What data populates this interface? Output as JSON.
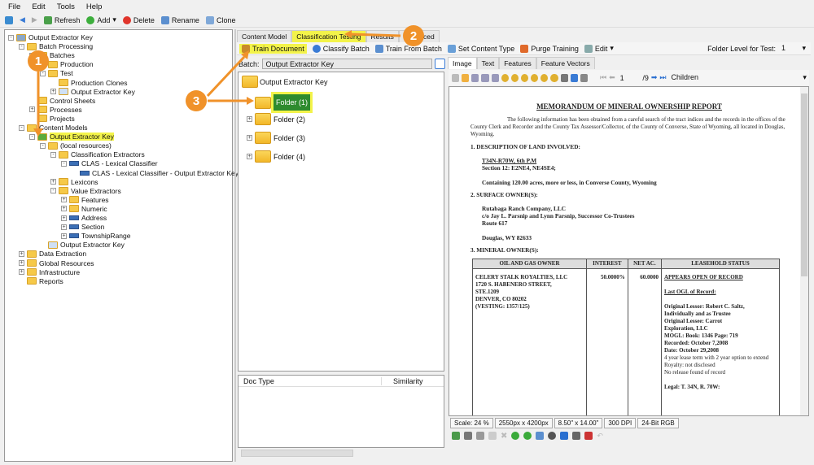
{
  "menu": [
    "File",
    "Edit",
    "Tools",
    "Help"
  ],
  "toolbar": {
    "refresh": "Refresh",
    "add": "Add",
    "delete": "Delete",
    "rename": "Rename",
    "clone": "Clone"
  },
  "tree": [
    {
      "label": "Output Extractor Key",
      "level": 0,
      "icon": "database-icon",
      "exp": "-"
    },
    {
      "label": "Batch Processing",
      "level": 1,
      "icon": "folder-icon",
      "exp": "-"
    },
    {
      "label": "Batches",
      "level": 2,
      "icon": "folder-icon",
      "exp": "-"
    },
    {
      "label": "Production",
      "level": 3,
      "icon": "batch-folder-icon",
      "exp": ""
    },
    {
      "label": "Test",
      "level": 3,
      "icon": "batch-folder-icon",
      "exp": "-"
    },
    {
      "label": "Production Clones",
      "level": 4,
      "icon": "batch-folder-icon",
      "exp": ""
    },
    {
      "label": "Output Extractor Key",
      "level": 4,
      "icon": "batch-icon",
      "exp": "+"
    },
    {
      "label": "Control Sheets",
      "level": 2,
      "icon": "folder-icon",
      "exp": ""
    },
    {
      "label": "Processes",
      "level": 2,
      "icon": "folder-icon",
      "exp": "+"
    },
    {
      "label": "Projects",
      "level": 2,
      "icon": "folder-icon",
      "exp": ""
    },
    {
      "label": "Content Models",
      "level": 1,
      "icon": "folder-icon",
      "exp": "-"
    },
    {
      "label": "Output Extractor Key",
      "level": 2,
      "icon": "content-model-icon",
      "exp": "-",
      "highlight": true
    },
    {
      "label": "(local resources)",
      "level": 3,
      "icon": "folder-icon",
      "exp": "-"
    },
    {
      "label": "Classification Extractors",
      "level": 4,
      "icon": "folder-icon",
      "exp": "-"
    },
    {
      "label": "CLAS - Lexical Classifier",
      "level": 5,
      "icon": "extractor-icon",
      "exp": "-"
    },
    {
      "label": "CLAS - Lexical Classifier - Output Extractor Key",
      "level": 6,
      "icon": "extractor-icon",
      "exp": ""
    },
    {
      "label": "Lexicons",
      "level": 4,
      "icon": "folder-icon",
      "exp": "+"
    },
    {
      "label": "Value Extractors",
      "level": 4,
      "icon": "folder-icon",
      "exp": "-"
    },
    {
      "label": "Features",
      "level": 5,
      "icon": "folder-icon",
      "exp": "+"
    },
    {
      "label": "Numeric",
      "level": 5,
      "icon": "folder-icon",
      "exp": "+"
    },
    {
      "label": "Address",
      "level": 5,
      "icon": "extractor-icon",
      "exp": "+"
    },
    {
      "label": "Section",
      "level": 5,
      "icon": "extractor-icon",
      "exp": "+"
    },
    {
      "label": "TownshipRange",
      "level": 5,
      "icon": "extractor-icon",
      "exp": "+"
    },
    {
      "label": "Output Extractor Key",
      "level": 3,
      "icon": "document-icon",
      "exp": ""
    },
    {
      "label": "Data Extraction",
      "level": 1,
      "icon": "folder-icon",
      "exp": "+"
    },
    {
      "label": "Global Resources",
      "level": 1,
      "icon": "folder-icon",
      "exp": "+"
    },
    {
      "label": "Infrastructure",
      "level": 1,
      "icon": "folder-icon",
      "exp": "+"
    },
    {
      "label": "Reports",
      "level": 1,
      "icon": "folder-icon",
      "exp": ""
    }
  ],
  "mid": {
    "tabs": [
      "Content Model",
      "Classification Testing",
      "Results",
      "Advanced"
    ],
    "toolbar": {
      "train_document": "Train Document",
      "classify_batch": "Classify Batch",
      "train_from_batch": "Train From Batch",
      "set_content_type": "Set Content Type",
      "purge_training": "Purge Training",
      "edit": "Edit",
      "folder_level_label": "Folder Level for Test:",
      "folder_level_value": "1"
    },
    "batch_label": "Batch:",
    "batch_value": "Output Extractor Key",
    "root_folder": "Output Extractor Key",
    "folders": [
      "Folder (1)",
      "Folder (2)",
      "Folder (3)",
      "Folder (4)"
    ],
    "list_headers": [
      "Doc Type",
      "Similarity"
    ]
  },
  "viewer": {
    "tabs": [
      "Image",
      "Text",
      "Features",
      "Feature Vectors"
    ],
    "page_current": "1",
    "page_total": "/9",
    "view_mode": "Children",
    "status": [
      "Scale: 24 %",
      "2550px x 4200px",
      "8.50\" x 14.00\"",
      "300 DPI",
      "24-Bit RGB"
    ]
  },
  "document": {
    "title": "MEMORANDUM OF MINERAL OWNERSHIP REPORT",
    "intro": "The following information has been obtained from a careful search of the tract indices and the records in the offices of the County Clerk and Recorder and the County Tax Assessor/Collector, of the County of Converse, State of Wyoming, all located in Douglas, Wyoming.",
    "s1": "1.   DESCRIPTION OF LAND INVOLVED:",
    "s1a": "T34N-R70W, 6th P.M",
    "s1b": "Section 12: E2NE4, NE4SE4;",
    "s1c": "Containing 120.00 acres, more or less, in Converse County, Wyoming",
    "s2": "2.   SURFACE OWNER(S):",
    "s2a": "Rutabaga Ranch Company, LLC",
    "s2b": "c/o Jay L. Parsnip and Lynn Parsnip, Successor Co-Trustees",
    "s2c": "Route 617",
    "s2d": "Douglas, WY 82633",
    "s3": "3.   MINERAL OWNER(S):",
    "table_headers": [
      "OIL AND GAS OWNER",
      "INTEREST",
      "NET AC.",
      "LEASEHOLD STATUS"
    ],
    "owner": [
      "CELERY STALK ROYALTIES, LLC",
      "1720 S. HABENERO STREET,",
      "STE.1209",
      "DENVER, CO 80202",
      "(VESTING: 1357/125)"
    ],
    "interest": "50.0000%",
    "net_ac": "60.0000",
    "status_head": "APPEARS OPEN OF RECORD",
    "status_sub": "Last OGL of Record:",
    "status_bold": [
      "Original Lessor: Robert C. Saltz,",
      "Individually and as Trustee",
      "Original Lessee: Carrot",
      "Exploration, LLC",
      "MOGL: Book: 1346 Page: 719",
      "Recorded: October 7,2008",
      "Date: October 29,2008"
    ],
    "status_plain": [
      "4 year lease term with 2 year option to extend",
      "Royalty: not disclosed",
      "No release found of record"
    ],
    "legal": "Legal: T. 34N, R. 70W:"
  },
  "callouts": [
    "1",
    "2",
    "3"
  ],
  "colors": {
    "callout": "#f0922a",
    "highlight": "#f3f34a",
    "selected_folder": "#2e8b2e"
  }
}
